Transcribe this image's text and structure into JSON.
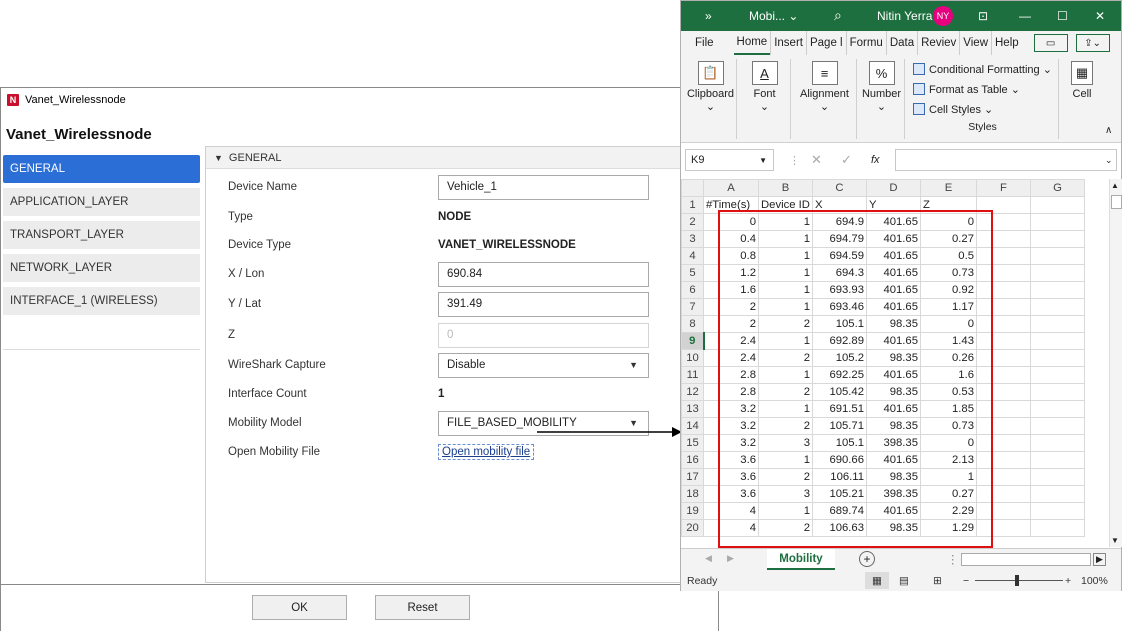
{
  "dialog": {
    "title": "Vanet_Wirelessnode",
    "heading": "Vanet_Wirelessnode",
    "logo_letter": "N",
    "nav": [
      "GENERAL",
      "APPLICATION_LAYER",
      "TRANSPORT_LAYER",
      "NETWORK_LAYER",
      "INTERFACE_1 (WIRELESS)"
    ],
    "section": "GENERAL",
    "fields": {
      "device_name": {
        "label": "Device Name",
        "value": "Vehicle_1"
      },
      "type": {
        "label": "Type",
        "value": "NODE"
      },
      "device_type": {
        "label": "Device Type",
        "value": "VANET_WIRELESSNODE"
      },
      "x_lon": {
        "label": "X / Lon",
        "value": "690.84"
      },
      "y_lat": {
        "label": "Y / Lat",
        "value": "391.49"
      },
      "z": {
        "label": "Z",
        "value": "0"
      },
      "wireshark": {
        "label": "WireShark Capture",
        "value": "Disable"
      },
      "interface_count": {
        "label": "Interface Count",
        "value": "1"
      },
      "mobility_model": {
        "label": "Mobility Model",
        "value": "FILE_BASED_MOBILITY"
      },
      "mobility_file": {
        "label": "Open Mobility File",
        "value": "Open mobility file"
      }
    },
    "ok_label": "OK",
    "reset_label": "Reset"
  },
  "excel": {
    "title_chevron": "»",
    "file_name": "Mobi... ⌄",
    "user_name": "Nitin Yerra",
    "user_initials": "NY",
    "tabs": [
      "File",
      "Home",
      "Insert",
      "Page l",
      "Formu",
      "Data",
      "Reviev",
      "View",
      "Help"
    ],
    "ribbon": {
      "clipboard": "Clipboard",
      "font": "Font",
      "alignment": "Alignment",
      "number": "Number",
      "cond_format": "Conditional Formatting ⌄",
      "format_table": "Format as Table ⌄",
      "cell_styles": "Cell Styles ⌄",
      "styles": "Styles",
      "cells": "Cell"
    },
    "name_box": "K9",
    "columns": [
      "A",
      "B",
      "C",
      "D",
      "E",
      "F",
      "G"
    ],
    "header_row": [
      "#Time(s)",
      "Device ID",
      "X",
      "Y",
      "Z"
    ],
    "rows": [
      [
        "0",
        "1",
        "694.9",
        "401.65",
        "0"
      ],
      [
        "0.4",
        "1",
        "694.79",
        "401.65",
        "0.27"
      ],
      [
        "0.8",
        "1",
        "694.59",
        "401.65",
        "0.5"
      ],
      [
        "1.2",
        "1",
        "694.3",
        "401.65",
        "0.73"
      ],
      [
        "1.6",
        "1",
        "693.93",
        "401.65",
        "0.92"
      ],
      [
        "2",
        "1",
        "693.46",
        "401.65",
        "1.17"
      ],
      [
        "2",
        "2",
        "105.1",
        "98.35",
        "0"
      ],
      [
        "2.4",
        "1",
        "692.89",
        "401.65",
        "1.43"
      ],
      [
        "2.4",
        "2",
        "105.2",
        "98.35",
        "0.26"
      ],
      [
        "2.8",
        "1",
        "692.25",
        "401.65",
        "1.6"
      ],
      [
        "2.8",
        "2",
        "105.42",
        "98.35",
        "0.53"
      ],
      [
        "3.2",
        "1",
        "691.51",
        "401.65",
        "1.85"
      ],
      [
        "3.2",
        "2",
        "105.71",
        "98.35",
        "0.73"
      ],
      [
        "3.2",
        "3",
        "105.1",
        "398.35",
        "0"
      ],
      [
        "3.6",
        "1",
        "690.66",
        "401.65",
        "2.13"
      ],
      [
        "3.6",
        "2",
        "106.11",
        "98.35",
        "1"
      ],
      [
        "3.6",
        "3",
        "105.21",
        "398.35",
        "0.27"
      ],
      [
        "4",
        "1",
        "689.74",
        "401.65",
        "2.29"
      ],
      [
        "4",
        "2",
        "106.63",
        "98.35",
        "1.29"
      ]
    ],
    "sheet_tab": "Mobility",
    "status": "Ready",
    "zoom": "100%"
  }
}
